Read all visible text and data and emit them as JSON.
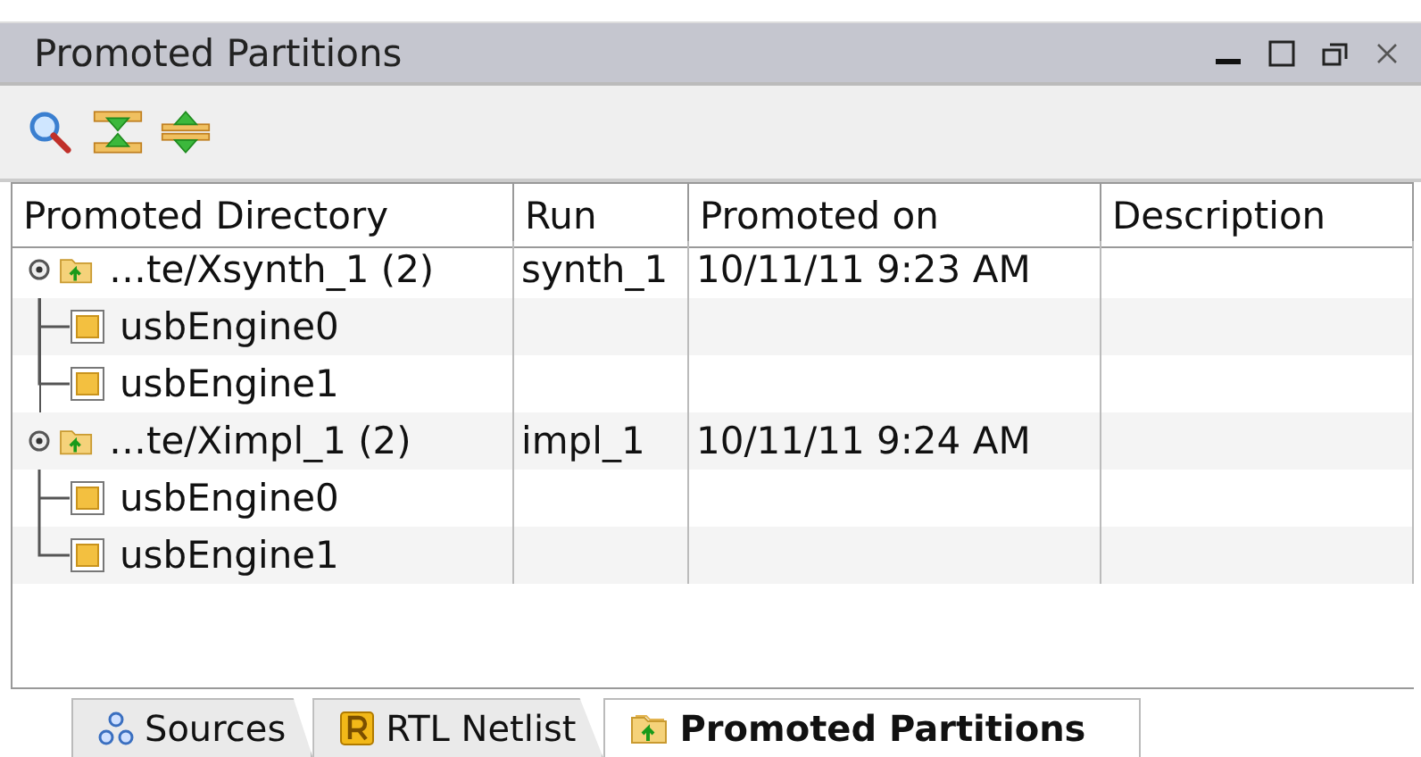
{
  "window": {
    "title": "Promoted Partitions"
  },
  "toolbar": [
    {
      "kind": "search"
    },
    {
      "kind": "collapse"
    },
    {
      "kind": "expand"
    }
  ],
  "table": {
    "columns": [
      "Promoted Directory",
      "Run",
      "Promoted on",
      "Description"
    ],
    "rows": [
      {
        "name": "…te/Xsynth_1 (2)",
        "run": "synth_1",
        "promoted_on": "10/11/11 9:23 AM",
        "expanded": true,
        "children": [
          {
            "name": "usbEngine0"
          },
          {
            "name": "usbEngine1"
          }
        ]
      },
      {
        "name": "…te/Ximpl_1 (2)",
        "run": "impl_1",
        "promoted_on": "10/11/11 9:24 AM",
        "expanded": true,
        "children": [
          {
            "name": "usbEngine0"
          },
          {
            "name": "usbEngine1"
          }
        ]
      }
    ]
  },
  "tabs": [
    {
      "label": "Sources",
      "kind": "sources",
      "selected": false
    },
    {
      "label": "RTL Netlist",
      "kind": "netlist",
      "selected": false
    },
    {
      "label": "Promoted Partitions",
      "kind": "promoted",
      "selected": true
    }
  ]
}
